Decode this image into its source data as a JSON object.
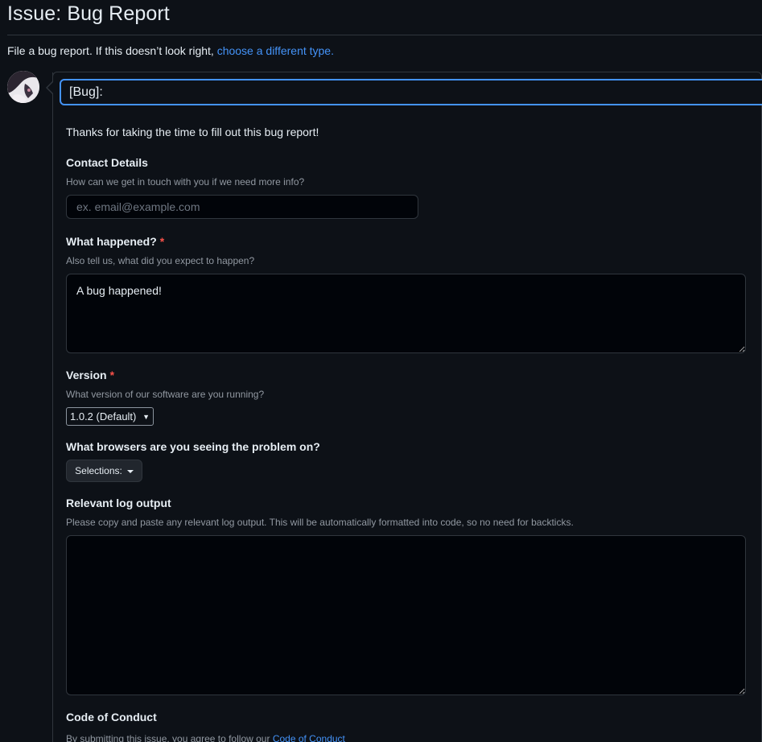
{
  "header": {
    "title": "Issue: Bug Report",
    "intro_text": "File a bug report. If this doesn’t look right,",
    "intro_link": "choose a different type."
  },
  "issue_title": {
    "value": "[Bug]: "
  },
  "form": {
    "thanks": "Thanks for taking the time to fill out this bug report!",
    "contact": {
      "label": "Contact Details",
      "description": "How can we get in touch with you if we need more info?",
      "placeholder": "ex. email@example.com"
    },
    "what_happened": {
      "label": "What happened?",
      "required_mark": "*",
      "description": "Also tell us, what did you expect to happen?",
      "value": "A bug happened!"
    },
    "version": {
      "label": "Version",
      "required_mark": "*",
      "description": "What version of our software are you running?",
      "selected": "1.0.2 (Default)"
    },
    "browsers": {
      "label": "What browsers are you seeing the problem on?",
      "button_label": "Selections:"
    },
    "logs": {
      "label": "Relevant log output",
      "description": "Please copy and paste any relevant log output. This will be automatically formatted into code, so no need for backticks."
    },
    "coc": {
      "label": "Code of Conduct",
      "description": "By submitting this issue, you agree to follow our",
      "link": "Code of Conduct"
    }
  },
  "colors": {
    "background": "#0d1117",
    "border": "#30363d",
    "accent": "#4493f8",
    "required": "#f85149",
    "muted_text": "#9198a1"
  }
}
